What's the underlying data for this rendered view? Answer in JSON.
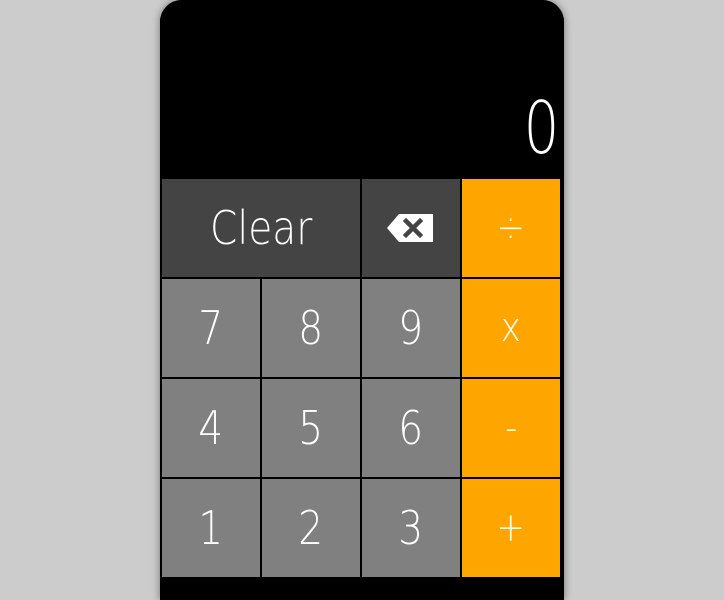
{
  "display": {
    "value": "0"
  },
  "keys": {
    "clear": "Clear",
    "divide": "÷",
    "multiply": "x",
    "subtract": "-",
    "add": "+",
    "seven": "7",
    "eight": "8",
    "nine": "9",
    "four": "4",
    "five": "5",
    "six": "6",
    "one": "1",
    "two": "2",
    "three": "3",
    "backspace_icon": "backspace-icon"
  },
  "colors": {
    "background": "#cccccc",
    "display": "#000000",
    "function_key": "#444444",
    "number_key": "#808080",
    "operator_key": "#ffa500",
    "text": "#ffffff"
  }
}
